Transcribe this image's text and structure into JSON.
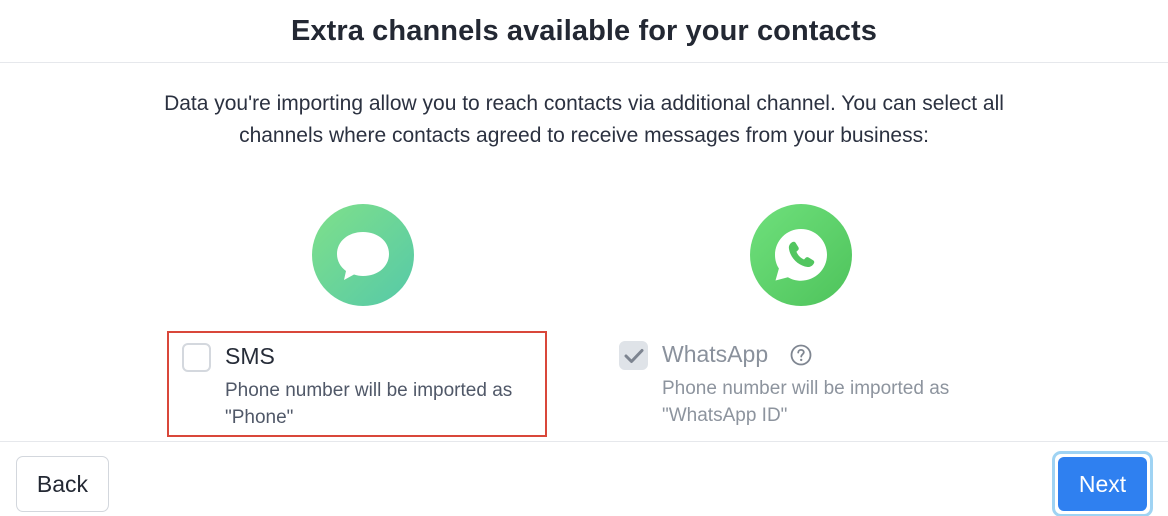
{
  "header": {
    "title": "Extra channels available for your contacts"
  },
  "intro": {
    "line1": "Data you're importing allow you to reach contacts via additional channel. You can select all",
    "line2": "channels where contacts agreed to receive messages from your business:"
  },
  "channels": [
    {
      "icon": "sms-chat-bubble-icon",
      "label": "SMS",
      "checked": false,
      "description": "Phone number will be imported as \"Phone\""
    },
    {
      "icon": "whatsapp-icon",
      "label": "WhatsApp",
      "checked": true,
      "disabled": true,
      "help_icon": "question-circle-icon",
      "description": "Phone number will be imported as \"WhatsApp ID\""
    }
  ],
  "footer": {
    "back_label": "Back",
    "next_label": "Next"
  },
  "colors": {
    "primary": "#2f80f0",
    "highlight_border": "#d9473a",
    "icon_green": "#56c9a8",
    "whatsapp_green": "#4ec35b"
  }
}
